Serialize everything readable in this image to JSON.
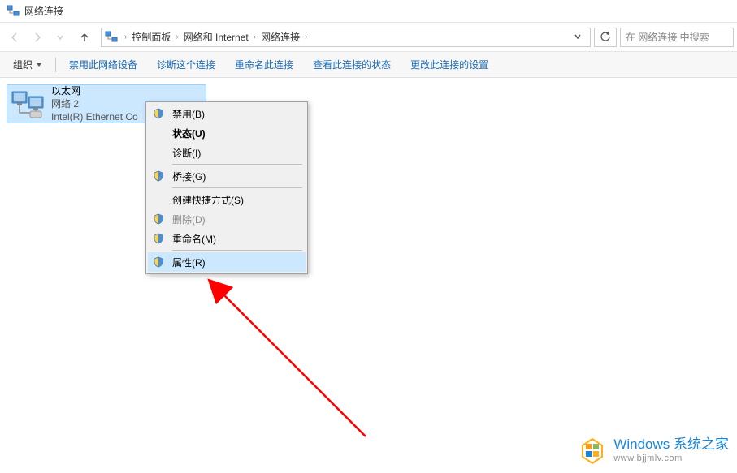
{
  "titlebar": {
    "title": "网络连接"
  },
  "breadcrumb": {
    "items": [
      "控制面板",
      "网络和 Internet",
      "网络连接"
    ]
  },
  "search": {
    "placeholder": "在 网络连接 中搜索"
  },
  "toolbar": {
    "organize": "组织",
    "items": [
      "禁用此网络设备",
      "诊断这个连接",
      "重命名此连接",
      "查看此连接的状态",
      "更改此连接的设置"
    ]
  },
  "adapter": {
    "name": "以太网",
    "status": "网络 2",
    "device": "Intel(R) Ethernet Co"
  },
  "context_menu": {
    "items": [
      {
        "label": "禁用(B)",
        "shield": true
      },
      {
        "label": "状态(U)",
        "bold": true
      },
      {
        "label": "诊断(I)"
      },
      {
        "sep": true
      },
      {
        "label": "桥接(G)",
        "shield": true
      },
      {
        "sep": true
      },
      {
        "label": "创建快捷方式(S)"
      },
      {
        "label": "删除(D)",
        "shield": true,
        "disabled": true
      },
      {
        "label": "重命名(M)",
        "shield": true
      },
      {
        "sep": true
      },
      {
        "label": "属性(R)",
        "shield": true,
        "hover": true
      }
    ]
  },
  "watermark": {
    "title": "Windows 系统之家",
    "url": "www.bjjmlv.com"
  }
}
